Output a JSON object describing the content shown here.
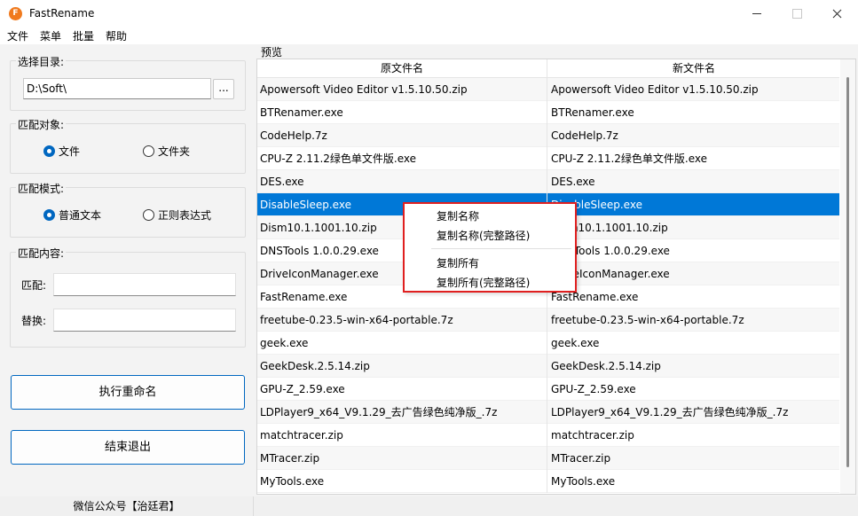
{
  "window": {
    "title": "FastRename",
    "icon_letter": "F"
  },
  "menu": [
    "文件",
    "菜单",
    "批量",
    "帮助"
  ],
  "dir_group": {
    "title": "选择目录:",
    "path": "D:\\Soft\\",
    "browse_label": "..."
  },
  "target_group": {
    "title": "匹配对象:",
    "options": [
      {
        "label": "文件",
        "checked": true
      },
      {
        "label": "文件夹",
        "checked": false
      }
    ]
  },
  "mode_group": {
    "title": "匹配模式:",
    "options": [
      {
        "label": "普通文本",
        "checked": true
      },
      {
        "label": "正则表达式",
        "checked": false
      }
    ]
  },
  "content_group": {
    "title": "匹配内容:",
    "match_label": "匹配:",
    "match_value": "",
    "replace_label": "替换:",
    "replace_value": ""
  },
  "buttons": {
    "rename": "执行重命名",
    "exit": "结束退出"
  },
  "status": "微信公众号【治廷君】",
  "preview": {
    "label": "预览",
    "columns": [
      "原文件名",
      "新文件名"
    ],
    "selected_index": 5,
    "rows": [
      [
        "Apowersoft Video Editor v1.5.10.50.zip",
        "Apowersoft Video Editor v1.5.10.50.zip"
      ],
      [
        "BTRenamer.exe",
        "BTRenamer.exe"
      ],
      [
        "CodeHelp.7z",
        "CodeHelp.7z"
      ],
      [
        "CPU-Z 2.11.2绿色单文件版.exe",
        "CPU-Z 2.11.2绿色单文件版.exe"
      ],
      [
        "DES.exe",
        "DES.exe"
      ],
      [
        "DisableSleep.exe",
        "DisableSleep.exe"
      ],
      [
        "Dism10.1.1001.10.zip",
        "Dism10.1.1001.10.zip"
      ],
      [
        "DNSTools 1.0.0.29.exe",
        "DNSTools 1.0.0.29.exe"
      ],
      [
        "DriveIconManager.exe",
        "DriveIconManager.exe"
      ],
      [
        "FastRename.exe",
        "FastRename.exe"
      ],
      [
        "freetube-0.23.5-win-x64-portable.7z",
        "freetube-0.23.5-win-x64-portable.7z"
      ],
      [
        "geek.exe",
        "geek.exe"
      ],
      [
        "GeekDesk.2.5.14.zip",
        "GeekDesk.2.5.14.zip"
      ],
      [
        "GPU-Z_2.59.exe",
        "GPU-Z_2.59.exe"
      ],
      [
        "LDPlayer9_x64_V9.1.29_去广告绿色纯净版_.7z",
        "LDPlayer9_x64_V9.1.29_去广告绿色纯净版_.7z"
      ],
      [
        "matchtracer.zip",
        "matchtracer.zip"
      ],
      [
        "MTracer.zip",
        "MTracer.zip"
      ],
      [
        "MyTools.exe",
        "MyTools.exe"
      ]
    ]
  },
  "context_menu": {
    "items": [
      "复制名称",
      "复制名称(完整路径)",
      "复制所有",
      "复制所有(完整路径)"
    ]
  }
}
